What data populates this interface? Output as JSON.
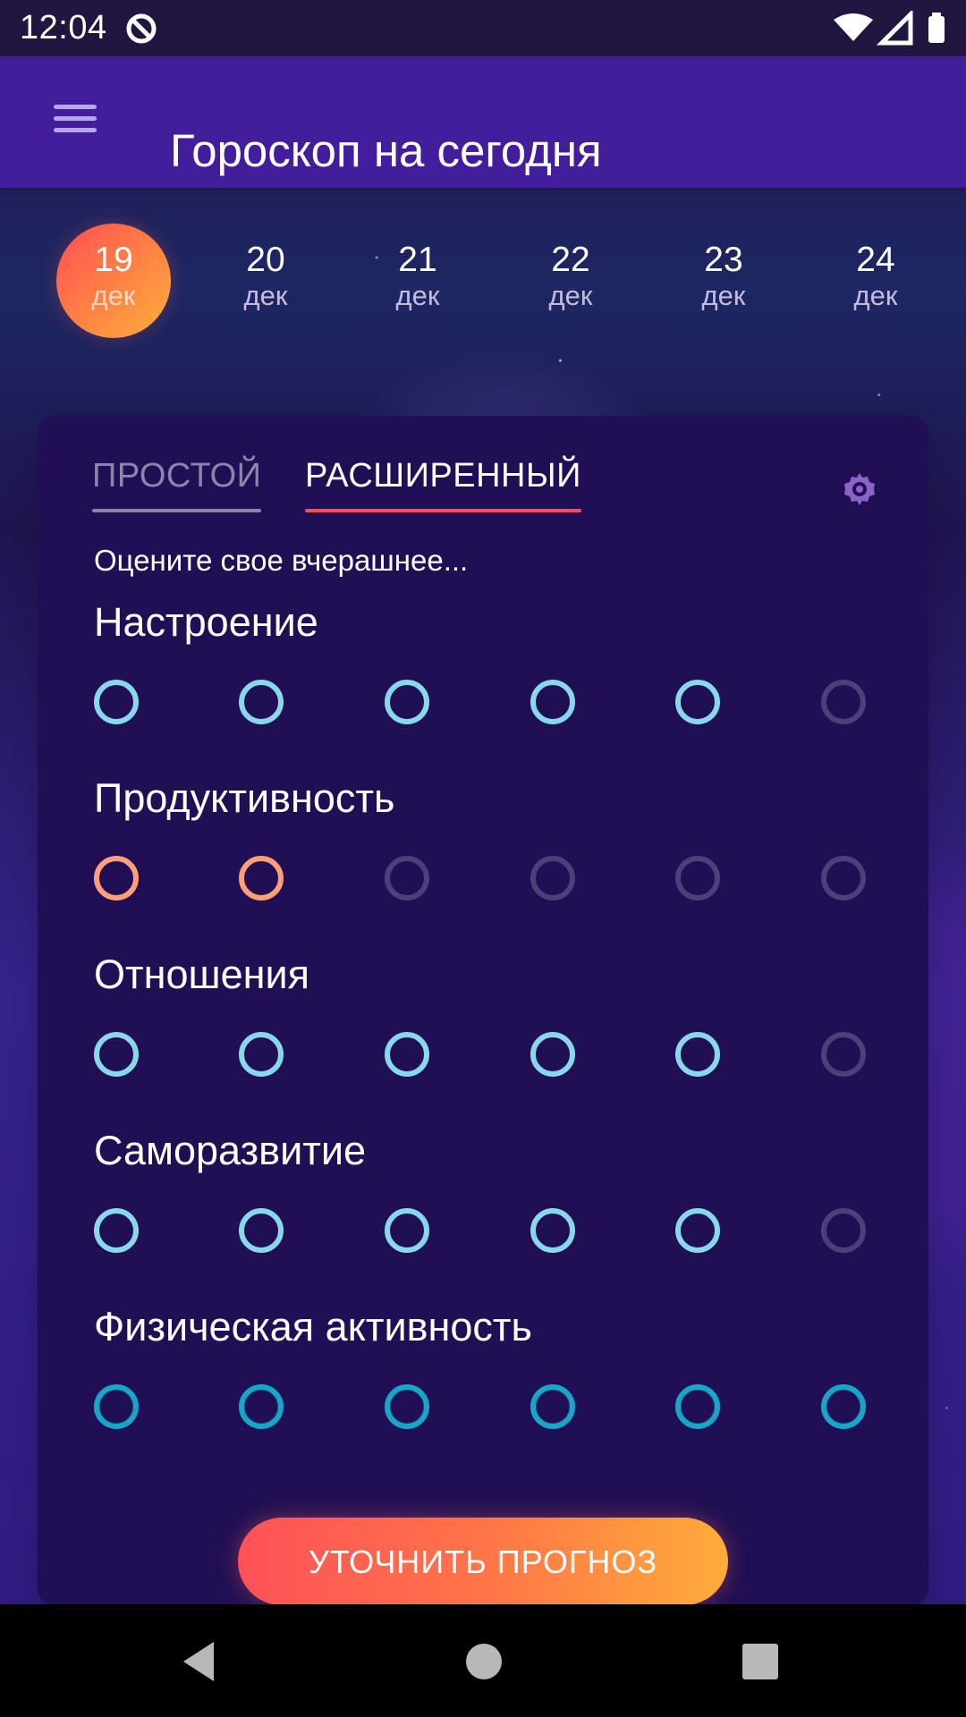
{
  "status_bar": {
    "time": "12:04",
    "icons": [
      "app-status-icon",
      "wifi-icon",
      "signal-icon",
      "battery-icon"
    ]
  },
  "app_bar": {
    "title": "Гороскоп на сегодня",
    "menu_icon": "menu-icon"
  },
  "date_strip": {
    "selected_index": 0,
    "items": [
      {
        "day": "19",
        "month": "дек"
      },
      {
        "day": "20",
        "month": "дек"
      },
      {
        "day": "21",
        "month": "дек"
      },
      {
        "day": "22",
        "month": "дек"
      },
      {
        "day": "23",
        "month": "дек"
      },
      {
        "day": "24",
        "month": "дек"
      }
    ]
  },
  "card": {
    "tabs": [
      {
        "label": "ПРОСТОЙ",
        "active": false
      },
      {
        "label": "РАСШИРЕННЫЙ",
        "active": true
      }
    ],
    "settings_icon": "gear-icon",
    "intro": "Оцените свое вчерашнее...",
    "categories": [
      {
        "label": "Настроение",
        "rating": 5,
        "max": 6,
        "style": "light-blue"
      },
      {
        "label": "Продуктивность",
        "rating": 2,
        "max": 6,
        "style": "orange"
      },
      {
        "label": "Отношения",
        "rating": 5,
        "max": 6,
        "style": "light-blue"
      },
      {
        "label": "Саморазвитие",
        "rating": 5,
        "max": 6,
        "style": "light-blue"
      },
      {
        "label": "Физическая активность",
        "rating": 6,
        "max": 6,
        "style": "teal"
      }
    ],
    "action_button": "УТОЧНИТЬ ПРОГНОЗ"
  },
  "navigation": {
    "back_icon": "back-icon",
    "home_icon": "home-icon",
    "recents_icon": "recents-icon"
  },
  "colors": {
    "app_bar": "#421e9d",
    "card": "#200f54",
    "accent_orange": "#ff7448",
    "rating_light_blue": "#88d8ea",
    "rating_orange": "#ff9f77",
    "rating_teal": "#17a6c8"
  }
}
